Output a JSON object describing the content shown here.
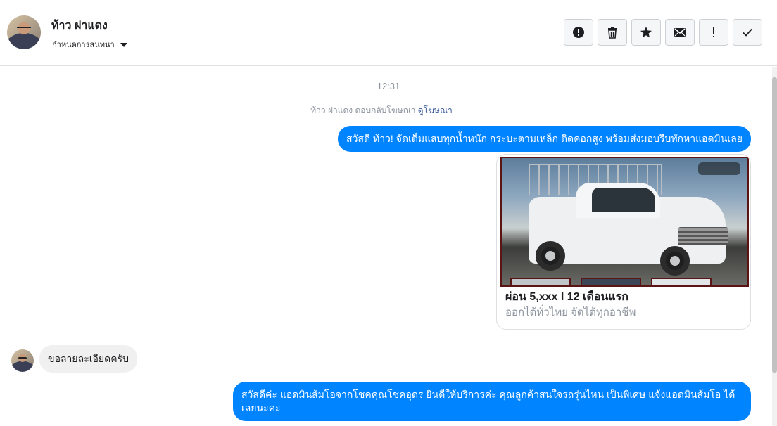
{
  "header": {
    "contact_name": "ท้าว ฝาแดง",
    "conversation_settings": "กำหนดการสนทนา",
    "actions": [
      {
        "icon": "alert-icon",
        "label": "report"
      },
      {
        "icon": "trash-icon",
        "label": "delete"
      },
      {
        "icon": "star-icon",
        "label": "star"
      },
      {
        "icon": "mail-icon",
        "label": "mark unread"
      },
      {
        "icon": "exclamation-icon",
        "label": "spam"
      },
      {
        "icon": "check-icon",
        "label": "done"
      }
    ]
  },
  "thread": {
    "timestamp": "12:31",
    "ad_reply_prefix": "ท้าว ฝาแดง ตอบกลับโฆษณา",
    "ad_reply_link": "ดูโฆษณา",
    "messages": [
      {
        "direction": "outgoing",
        "text": "สวัสดี ท้าว! จัดเต็มแสบทุกน้ำหนัก กระบะตามเหล็ก ติดคอกสูง พร้อมส่งมอบรีบทักหาแอดมินเลย"
      },
      {
        "direction": "incoming",
        "text": "ขอลายละเอียดครับ"
      },
      {
        "direction": "outgoing",
        "text": "สวัสดีค่ะ แอดมินส้มโอจากโชคคุณโชคอุดร ยินดีให้บริการค่ะ   คุณลูกค้าสนใจรถรุ่นไหน เป็นพิเศษ แจ้งแอดมินส้มโอ ได้เลยนะคะ"
      }
    ],
    "ad_card": {
      "title": "ผ่อน 5,xxx I 12 เดือนแรก",
      "description": "ออกได้ทั่วไทย จัดได้ทุกอาชีพ"
    }
  },
  "colors": {
    "outgoing_bubble": "#0084ff",
    "incoming_bubble": "#f1f0f0",
    "link": "#385898"
  }
}
